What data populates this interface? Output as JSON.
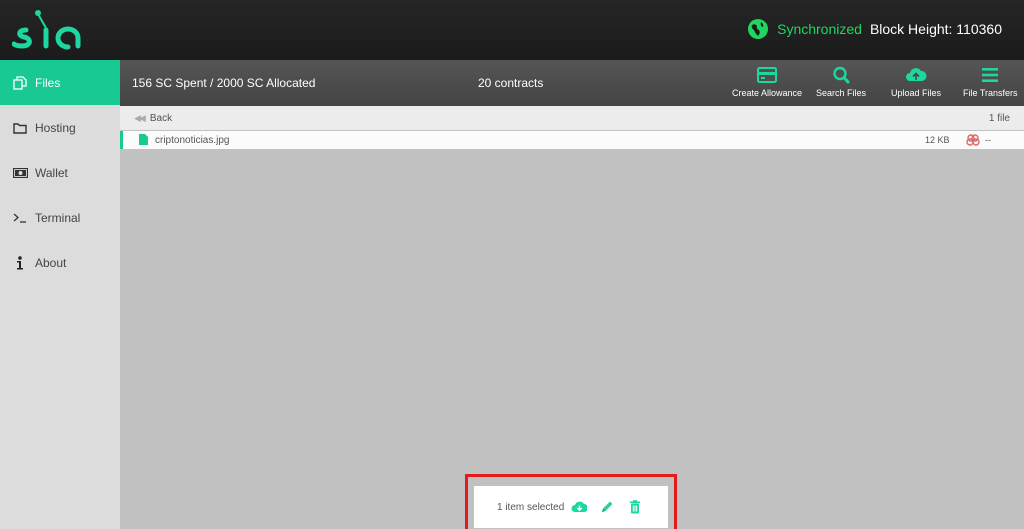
{
  "header": {
    "logo_text": "sia",
    "sync_status": "Synchronized",
    "block_height": "Block Height: 110360",
    "accent_color": "#1ed660"
  },
  "sidebar": {
    "items": [
      {
        "label": "Files",
        "icon": "files-icon",
        "active": true
      },
      {
        "label": "Hosting",
        "icon": "folder-icon"
      },
      {
        "label": "Wallet",
        "icon": "money-icon"
      },
      {
        "label": "Terminal",
        "icon": "terminal-icon"
      },
      {
        "label": "About",
        "icon": "info-icon"
      }
    ]
  },
  "toolbar": {
    "spent": "156 SC Spent / 2000 SC Allocated",
    "contracts": "20 contracts",
    "buttons": [
      {
        "label": "Create Allowance",
        "icon": "credit-card-icon"
      },
      {
        "label": "Search Files",
        "icon": "search-icon"
      },
      {
        "label": "Upload Files",
        "icon": "cloud-upload-icon"
      },
      {
        "label": "File Transfers",
        "icon": "menu-icon"
      }
    ]
  },
  "breadcrumb": {
    "back_label": "Back",
    "file_count": "1 file"
  },
  "files": [
    {
      "name": "criptonoticias.jpg",
      "size": "12 KB",
      "redundancy": "--"
    }
  ],
  "selection": {
    "text": "1 item selected",
    "actions": [
      "download-icon",
      "rename-icon",
      "delete-icon"
    ]
  }
}
